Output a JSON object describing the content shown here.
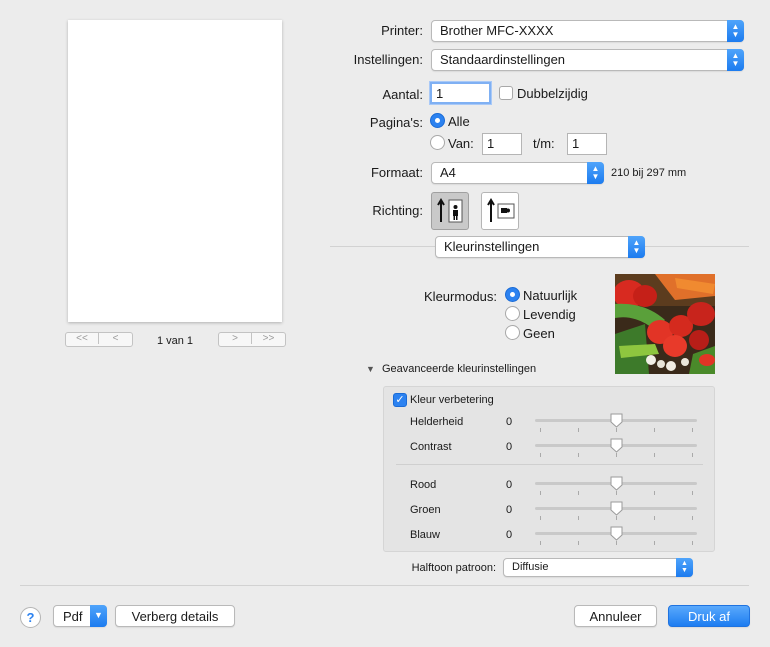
{
  "preview": {
    "page_indicator": "1 van 1",
    "first_label": "<<",
    "prev_label": "<",
    "next_label": ">",
    "last_label": ">>"
  },
  "printer": {
    "label": "Printer:",
    "value": "Brother MFC-XXXX"
  },
  "settings": {
    "label": "Instellingen:",
    "value": "Standaardinstellingen"
  },
  "copies": {
    "label": "Aantal:",
    "value": "1",
    "duplex_label": "Dubbelzijdig",
    "duplex_checked": false
  },
  "pages": {
    "label": "Pagina's:",
    "all_label": "Alle",
    "from_label": "Van:",
    "from_value": "1",
    "to_label": "t/m:",
    "to_value": "1"
  },
  "format": {
    "label": "Formaat:",
    "value": "A4",
    "size_text": "210 bij 297 mm"
  },
  "orientation": {
    "label": "Richting:"
  },
  "section_popup": {
    "value": "Kleurinstellingen"
  },
  "color_mode": {
    "label": "Kleurmodus:",
    "options": [
      "Natuurlijk",
      "Levendig",
      "Geen"
    ],
    "selected": "Natuurlijk"
  },
  "advanced": {
    "disclosure_label": "Geavanceerde kleurinstellingen",
    "enhance_label": "Kleur verbetering",
    "enhance_checked": true,
    "sliders_a": [
      {
        "name": "Helderheid",
        "value": "0"
      },
      {
        "name": "Contrast",
        "value": "0"
      }
    ],
    "sliders_b": [
      {
        "name": "Rood",
        "value": "0"
      },
      {
        "name": "Groen",
        "value": "0"
      },
      {
        "name": "Blauw",
        "value": "0"
      }
    ],
    "slider_level": 0.5
  },
  "halftone": {
    "label": "Halftoon patroon:",
    "value": "Diffusie"
  },
  "footer": {
    "help_label": "?",
    "pdf_label": "Pdf",
    "hide_details_label": "Verberg details",
    "cancel_label": "Annuleer",
    "print_label": "Druk af"
  },
  "colors": {
    "accent": "#2c82f0",
    "background": "#ececec"
  }
}
